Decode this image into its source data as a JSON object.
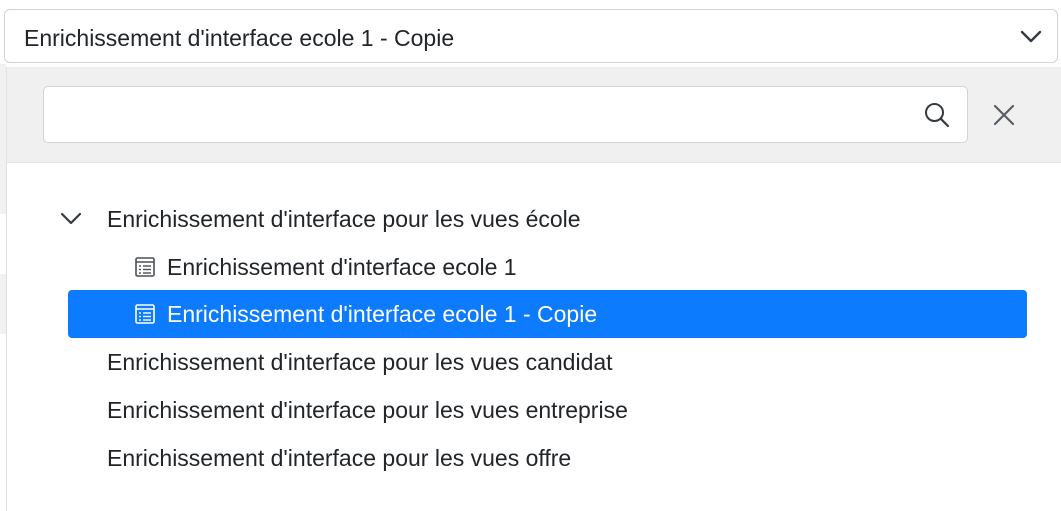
{
  "select": {
    "value": "Enrichissement d'interface ecole 1 - Copie",
    "chevron_icon": "chevron-down-icon"
  },
  "search": {
    "value": "",
    "placeholder": "",
    "search_icon": "search-icon",
    "close_icon": "close-icon"
  },
  "tree": {
    "groups": [
      {
        "label": "Enrichissement d'interface pour les vues école",
        "expanded": true
      },
      {
        "label": "Enrichissement d'interface pour les vues candidat",
        "expanded": false
      },
      {
        "label": "Enrichissement d'interface pour les vues entreprise",
        "expanded": false
      },
      {
        "label": "Enrichissement d'interface pour les vues offre",
        "expanded": false
      }
    ],
    "children": [
      {
        "label": "Enrichissement d'interface ecole 1",
        "icon": "document-list-icon",
        "selected": false
      },
      {
        "label": "Enrichissement d'interface ecole 1 - Copie",
        "icon": "document-list-icon",
        "selected": true
      }
    ]
  },
  "colors": {
    "selected_bg": "#0d7bfd",
    "search_bar_bg": "#f0f0f0",
    "text": "#212529"
  }
}
